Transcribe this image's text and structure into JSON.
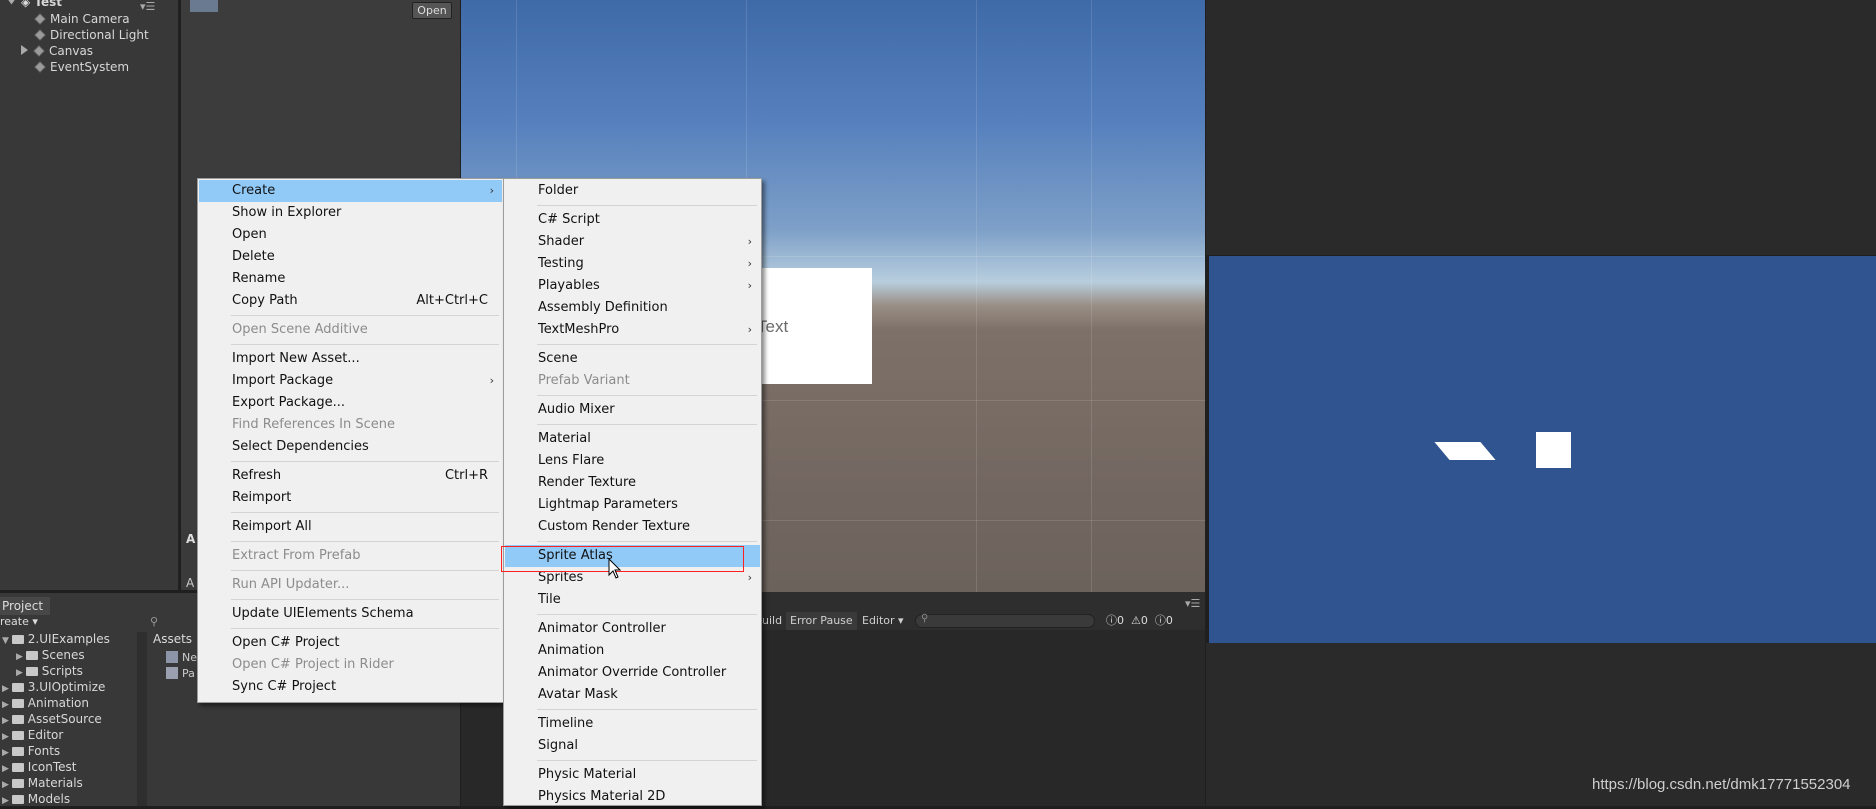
{
  "hierarchy": {
    "scene_name": "Test",
    "items": [
      {
        "label": "Main Camera"
      },
      {
        "label": "Directional Light"
      },
      {
        "label": "Canvas"
      },
      {
        "label": "EventSystem"
      }
    ]
  },
  "inspector": {
    "open_button": "Open",
    "letter_top": "A",
    "letter_bottom": "A"
  },
  "scene_view": {
    "text_label": "Text"
  },
  "console": {
    "build": "uild",
    "error_pause": "Error Pause",
    "editor": "Editor ▾",
    "counts": [
      "0",
      "0",
      "0"
    ],
    "menu_icon": "▾☰"
  },
  "project": {
    "tab": "Project",
    "create": "reate ▾",
    "tree": [
      {
        "label": "2.UIExamples"
      },
      {
        "label": "Scenes"
      },
      {
        "label": "Scripts"
      },
      {
        "label": "3.UIOptimize"
      },
      {
        "label": "Animation"
      },
      {
        "label": "AssetSource"
      },
      {
        "label": "Editor"
      },
      {
        "label": "Fonts"
      },
      {
        "label": "IconTest"
      },
      {
        "label": "Materials"
      },
      {
        "label": "Models"
      }
    ],
    "assets_label": "Assets",
    "asset_items": [
      {
        "label": "Ne"
      },
      {
        "label": "Pa"
      }
    ]
  },
  "context_menu": {
    "items": [
      {
        "label": "Create",
        "arrow": "›"
      },
      {
        "label": "Show in Explorer"
      },
      {
        "label": "Open"
      },
      {
        "label": "Delete"
      },
      {
        "label": "Rename"
      },
      {
        "label": "Copy Path",
        "shortcut": "Alt+Ctrl+C"
      },
      {
        "label": "Open Scene Additive"
      },
      {
        "label": "Import New Asset..."
      },
      {
        "label": "Import Package",
        "arrow": "›"
      },
      {
        "label": "Export Package..."
      },
      {
        "label": "Find References In Scene"
      },
      {
        "label": "Select Dependencies"
      },
      {
        "label": "Refresh",
        "shortcut": "Ctrl+R"
      },
      {
        "label": "Reimport"
      },
      {
        "label": "Reimport All"
      },
      {
        "label": "Extract From Prefab"
      },
      {
        "label": "Run API Updater..."
      },
      {
        "label": "Update UIElements Schema"
      },
      {
        "label": "Open C# Project"
      },
      {
        "label": "Open C# Project in Rider"
      },
      {
        "label": "Sync C# Project"
      }
    ]
  },
  "create_submenu": {
    "items": [
      {
        "label": "Folder"
      },
      {
        "label": "C# Script"
      },
      {
        "label": "Shader",
        "arrow": "›"
      },
      {
        "label": "Testing",
        "arrow": "›"
      },
      {
        "label": "Playables",
        "arrow": "›"
      },
      {
        "label": "Assembly Definition"
      },
      {
        "label": "TextMeshPro",
        "arrow": "›"
      },
      {
        "label": "Scene"
      },
      {
        "label": "Prefab Variant"
      },
      {
        "label": "Audio Mixer"
      },
      {
        "label": "Material"
      },
      {
        "label": "Lens Flare"
      },
      {
        "label": "Render Texture"
      },
      {
        "label": "Lightmap Parameters"
      },
      {
        "label": "Custom Render Texture"
      },
      {
        "label": "Sprite Atlas"
      },
      {
        "label": "Sprites",
        "arrow": "›"
      },
      {
        "label": "Tile"
      },
      {
        "label": "Animator Controller"
      },
      {
        "label": "Animation"
      },
      {
        "label": "Animator Override Controller"
      },
      {
        "label": "Avatar Mask"
      },
      {
        "label": "Timeline"
      },
      {
        "label": "Signal"
      },
      {
        "label": "Physic Material"
      },
      {
        "label": "Physics Material 2D"
      }
    ]
  },
  "watermark": "https://blog.csdn.net/dmk17771552304"
}
